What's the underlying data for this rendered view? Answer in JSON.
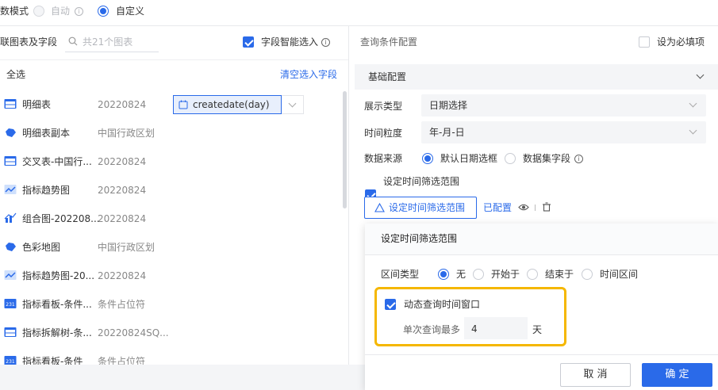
{
  "top_bar": {
    "mode_label": "数模式",
    "option_auto": "自动",
    "option_custom": "自定义"
  },
  "left_panel": {
    "title": "联图表及字段",
    "search_placeholder": "共21个图表",
    "smart_select_label": "字段智能选入",
    "select_all": "全选",
    "clear_selection": "清空选入字段",
    "field_tag": "createdate(day)",
    "rows": [
      {
        "icon": "table-icon",
        "name": "明细表",
        "field": "20220824"
      },
      {
        "icon": "map-icon",
        "name": "明细表副本",
        "field": "中国行政区划"
      },
      {
        "icon": "table-icon",
        "name": "交叉表-中国行...",
        "field": "20220824"
      },
      {
        "icon": "trend-icon",
        "name": "指标趋势图",
        "field": "20220824"
      },
      {
        "icon": "combo-icon",
        "name": "组合图-202208...",
        "field": "20220824"
      },
      {
        "icon": "map-icon",
        "name": "色彩地图",
        "field": "中国行政区划"
      },
      {
        "icon": "trend-icon",
        "name": "指标趋势图-20...",
        "field": "20220824"
      },
      {
        "icon": "kpi-icon",
        "name": "指标看板-条件...",
        "field": "条件占位符"
      },
      {
        "icon": "table-icon",
        "name": "指标拆解树-条...",
        "field": "20220824SQ..."
      },
      {
        "icon": "kpi-icon",
        "name": "指标看板-条件",
        "field": "条件占位符"
      }
    ]
  },
  "right_panel": {
    "title": "查询条件配置",
    "required_label": "设为必填项",
    "section_title": "基础配置",
    "display_type_label": "展示类型",
    "display_type_value": "日期选择",
    "granularity_label": "时间粒度",
    "granularity_value": "年-月-日",
    "source_label": "数据来源",
    "source_default": "默认日期选框",
    "source_dataset": "数据集字段",
    "range_check_label": "设定时间筛选范围",
    "range_button": "设定时间筛选范围",
    "configured": "已配置"
  },
  "popup": {
    "title": "设定时间筛选范围",
    "interval_label": "区间类型",
    "opt_none": "无",
    "opt_start": "开始于",
    "opt_end": "结束于",
    "opt_range": "时间区间",
    "dynamic_label": "动态查询时间窗口",
    "max_label": "单次查询最多",
    "max_value": "4",
    "unit": "天"
  },
  "footer": {
    "cancel": "取 消",
    "confirm": "确 定"
  },
  "colors": {
    "accent": "#2a6ae9",
    "highlight": "#f5b700"
  }
}
